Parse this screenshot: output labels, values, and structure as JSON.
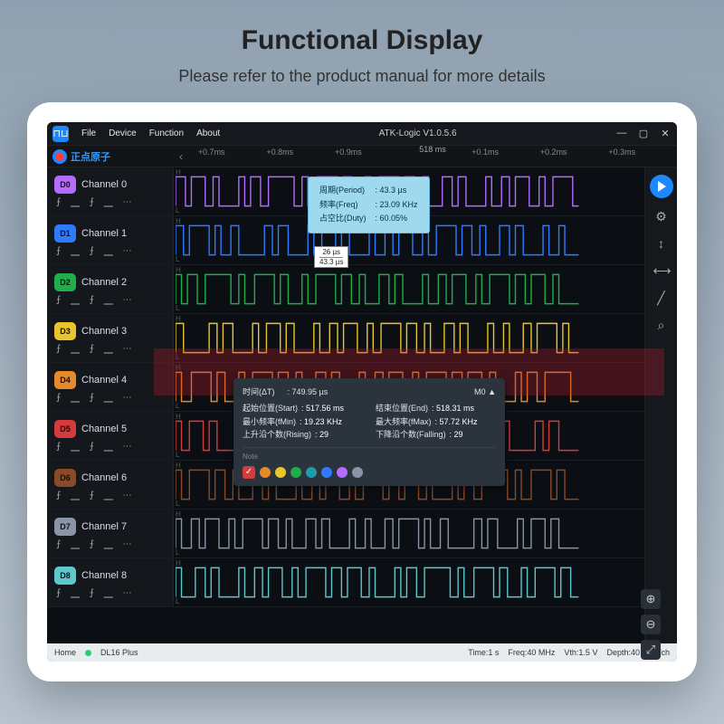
{
  "promo": {
    "title": "Functional Display",
    "subtitle": "Please refer to the product manual for more details"
  },
  "menu": {
    "file": "File",
    "device": "Device",
    "function": "Function",
    "about": "About"
  },
  "app_title": "ATK-Logic  V1.0.5.6",
  "brand": "正点原子",
  "ruler_top": "518 ms",
  "ticks": {
    "t0": "+0.7ms",
    "t1": "+0.8ms",
    "t2": "+0.9ms",
    "t3": "+0.1ms",
    "t4": "+0.2ms",
    "t5": "+0.3ms"
  },
  "channels": [
    {
      "badge": "D0",
      "name": "Channel 0",
      "color": "#b56bff"
    },
    {
      "badge": "D1",
      "name": "Channel 1",
      "color": "#2f7bff"
    },
    {
      "badge": "D2",
      "name": "Channel 2",
      "color": "#1fae4a"
    },
    {
      "badge": "D3",
      "name": "Channel 3",
      "color": "#e9c52c"
    },
    {
      "badge": "D4",
      "name": "Channel 4",
      "color": "#e6892b"
    },
    {
      "badge": "D5",
      "name": "Channel 5",
      "color": "#d63b3b"
    },
    {
      "badge": "D6",
      "name": "Channel 6",
      "color": "#8a4a28"
    },
    {
      "badge": "D7",
      "name": "Channel 7",
      "color": "#8a94a6"
    },
    {
      "badge": "D8",
      "name": "Channel 8",
      "color": "#5cc8cc"
    }
  ],
  "period_box": {
    "r1l": "周期(Period)",
    "r1v": ": 43.3 µs",
    "r2l": "频率(Freq)",
    "r2v": ": 23.09 KHz",
    "r3l": "占空比(Duty)",
    "r3v": ": 60.05%"
  },
  "cursor_box": {
    "l1": "26 µs",
    "l2": "43.3 µs"
  },
  "m0": {
    "title": "M0",
    "expand": "▲",
    "r1a_l": "时间(ΔT)",
    "r1a_v": ": 749.95 µs",
    "r2a_l": "起始位置(Start)",
    "r2a_v": ": 517.56 ms",
    "r2b_l": "结束位置(End)",
    "r2b_v": ": 518.31 ms",
    "r3a_l": "最小频率(fMin)",
    "r3a_v": ": 19.23 KHz",
    "r3b_l": "最大频率(fMax)",
    "r3b_v": ": 57.72 KHz",
    "r4a_l": "上升沿个数(Rising)",
    "r4a_v": ": 29",
    "r4b_l": "下降沿个数(Falling)",
    "r4b_v": ": 29",
    "note": "Note"
  },
  "note_colors": [
    "#d63b3b",
    "#e6892b",
    "#e9c52c",
    "#1fae4a",
    "#1f9bae",
    "#2f7bff",
    "#b56bff",
    "#8a94a6"
  ],
  "status": {
    "home": "Home",
    "dev": "DL16 Plus",
    "time": "Time:1 s",
    "freq": "Freq:40 MHz",
    "vth": "Vth:1.5 V",
    "depth": "Depth:40 MSa/ch"
  },
  "glyphs": {
    "edge": "⨍  ⎽  ⨍  ⎽  ⋯"
  }
}
